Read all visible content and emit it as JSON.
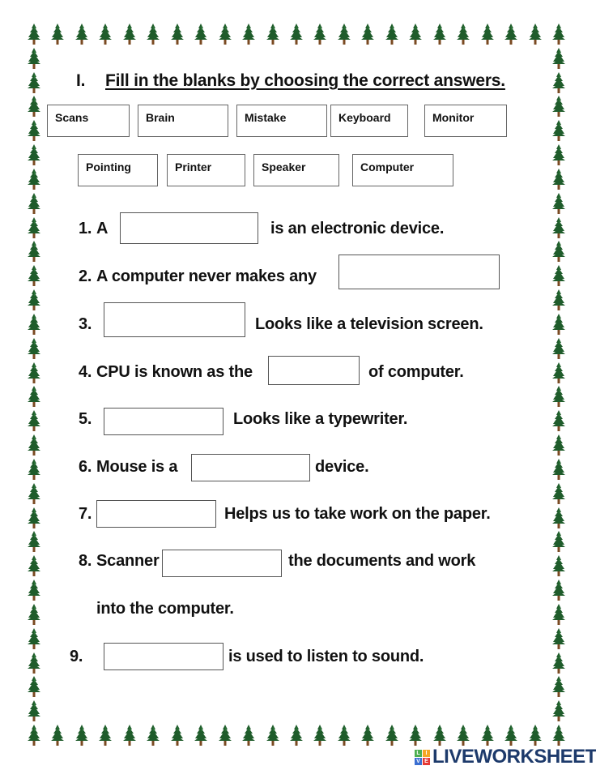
{
  "section": {
    "number": "I.",
    "title": "Fill in the blanks by choosing the correct answers."
  },
  "word_bank": [
    "Scans",
    "Brain",
    "Mistake",
    "Keyboard",
    "Monitor",
    "Pointing",
    "Printer",
    "Speaker",
    "Computer"
  ],
  "questions": [
    {
      "num": "1.",
      "before": "A",
      "after": "is an electronic device.",
      "answer": ""
    },
    {
      "num": "2.",
      "before": "A computer never makes any",
      "after": "",
      "answer": ""
    },
    {
      "num": "3.",
      "before": "",
      "after": "Looks like a television screen.",
      "answer": ""
    },
    {
      "num": "4.",
      "before": "CPU is known as the",
      "after": "of computer.",
      "answer": ""
    },
    {
      "num": "5.",
      "before": "",
      "after": "Looks like a typewriter.",
      "answer": ""
    },
    {
      "num": "6.",
      "before": "Mouse is a",
      "after": "device.",
      "answer": ""
    },
    {
      "num": "7.",
      "before": "",
      "after": "Helps us to take work on the paper.",
      "answer": ""
    },
    {
      "num": "8.",
      "before": "Scanner",
      "after": "the documents and work",
      "continuation": "into the computer.",
      "answer": ""
    },
    {
      "num": "9.",
      "before": "",
      "after": "is used to listen to sound.",
      "answer": ""
    }
  ],
  "border": {
    "icon": "pine-tree-icon",
    "tree_color": "#1f5c2b",
    "trunk_color": "#7a4a22"
  },
  "branding": {
    "logo_letters": [
      "L",
      "I",
      "V",
      "E"
    ],
    "logo_colors": [
      "#4caf50",
      "#f5a623",
      "#3b6fd1",
      "#e53935"
    ],
    "name": "LIVEWORKSHEETS"
  }
}
